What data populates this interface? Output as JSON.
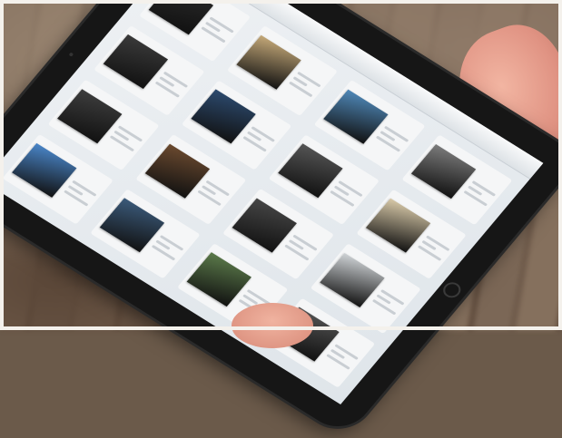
{
  "scene": {
    "background": "blurred-brick-wall",
    "device": "tablet-held-in-hand"
  },
  "tablet_screen": {
    "tiles": [
      {
        "photo_color": "#2b2b2b",
        "kind": "dark-photo"
      },
      {
        "photo_color": "#c4a878",
        "kind": "warm-photo"
      },
      {
        "photo_color": "#4f88b8",
        "kind": "blue-photo"
      },
      {
        "photo_color": "#7b7b7b",
        "kind": "gray-photo"
      },
      {
        "photo_color": "#3a3a3a",
        "kind": "bw-photo"
      },
      {
        "photo_color": "#2c4a6e",
        "kind": "dark-blue-photo"
      },
      {
        "photo_color": "#555555",
        "kind": "bw-photo"
      },
      {
        "photo_color": "#d8c9a8",
        "kind": "light-photo"
      },
      {
        "photo_color": "#3d3d3d",
        "kind": "bw-photo"
      },
      {
        "photo_color": "#6b4a2f",
        "kind": "brown-photo"
      },
      {
        "photo_color": "#464646",
        "kind": "bw-photo"
      },
      {
        "photo_color": "#cfd3d6",
        "kind": "light-photo"
      },
      {
        "photo_color": "#4a86c9",
        "kind": "sky-photo"
      },
      {
        "photo_color": "#3b5a7a",
        "kind": "blue-photo"
      },
      {
        "photo_color": "#5b7a4a",
        "kind": "landscape-photo"
      },
      {
        "photo_color": "#555555",
        "kind": "bw-photo"
      }
    ]
  }
}
